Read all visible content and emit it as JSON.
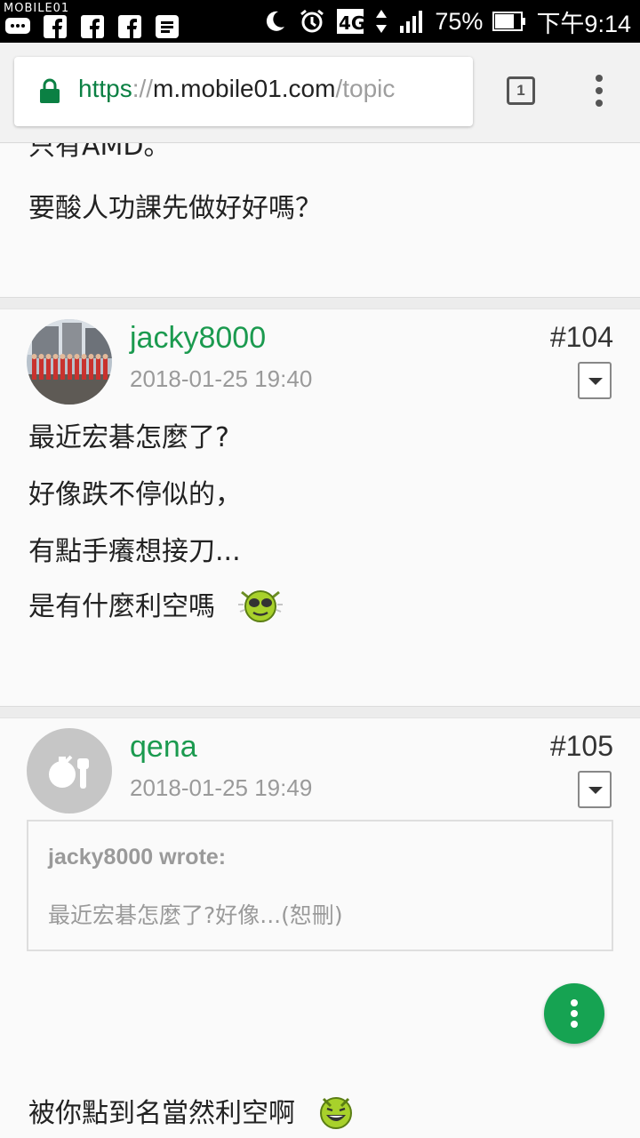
{
  "status_bar": {
    "watermark": "MOBILE01",
    "network": "4G",
    "battery": "75%",
    "time": "下午9:14"
  },
  "browser": {
    "url_scheme": "https",
    "url_sep": "://",
    "url_host": "m.mobile01.com",
    "url_path": "/topic",
    "tab_count": "1"
  },
  "previous_post": {
    "lines": [
      "只有AMD。",
      "要酸人功課先做好好嗎？"
    ]
  },
  "posts": [
    {
      "username": "jacky8000",
      "date": "2018-01-25 19:40",
      "number": "#104",
      "lines": [
        "最近宏碁怎麼了?",
        "好像跌不停似的，",
        "有點手癢想接刀...",
        "是有什麼利空嗎"
      ],
      "emoji": "cool-devil-emoji"
    },
    {
      "username": "qena",
      "date": "2018-01-25 19:49",
      "number": "#105",
      "quote": {
        "title": "jacky8000 wrote:",
        "body": "最近宏碁怎麼了?好像...(恕刪)"
      },
      "lines": [
        "被你點到名當然利空啊"
      ],
      "emoji": "laughing-emoji"
    }
  ],
  "colors": {
    "accent_green": "#1b9a4f",
    "fab_green": "#16a352",
    "secure_green": "#0b8043"
  }
}
